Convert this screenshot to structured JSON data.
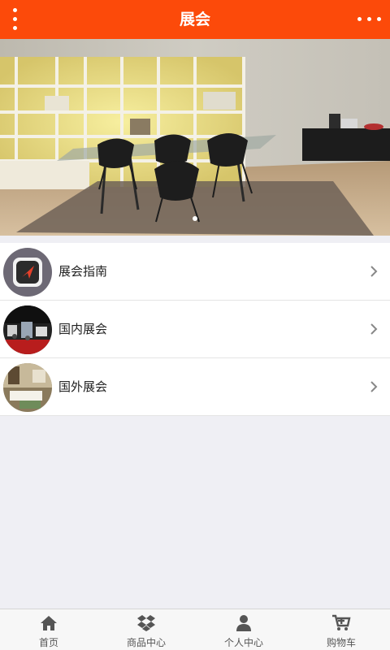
{
  "header": {
    "title": "展会",
    "menu_icon": "more-vertical-icon",
    "more_icon": "more-horizontal-icon",
    "bg_color": "#fc4a0a"
  },
  "banner": {
    "image": "dining-room-showcase",
    "slide_count": 1,
    "active_slide": 1
  },
  "list": {
    "items": [
      {
        "label": "展会指南",
        "thumb": "compass-app-icon"
      },
      {
        "label": "国内展会",
        "thumb": "domestic-exhibition-photo"
      },
      {
        "label": "国外展会",
        "thumb": "foreign-exhibition-photo"
      }
    ]
  },
  "tabbar": {
    "items": [
      {
        "label": "首页",
        "icon": "home-icon"
      },
      {
        "label": "商品中心",
        "icon": "dropbox-icon"
      },
      {
        "label": "个人中心",
        "icon": "user-icon"
      },
      {
        "label": "购物车",
        "icon": "cart-icon"
      }
    ]
  }
}
